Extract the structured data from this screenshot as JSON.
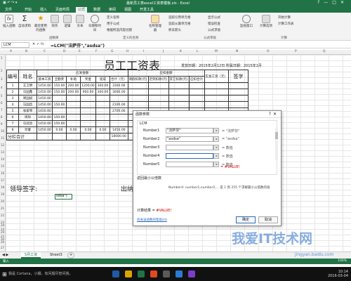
{
  "window": {
    "title": "最新员工表excel工资表模板.xls - Excel",
    "buttons": [
      "?",
      "—",
      "□",
      "✕"
    ],
    "accent_color": "#217346"
  },
  "ribbon": {
    "tabs": [
      "文件",
      "开始",
      "插入",
      "页面布局",
      "公式",
      "数据",
      "审阅",
      "视图",
      "开发工具"
    ],
    "active_tab": "公式",
    "big_buttons": [
      {
        "label": "插入函数",
        "icon": "fx-icon"
      },
      {
        "label": "自动求和",
        "icon": "sum-icon"
      },
      {
        "label": "最近使用的函数",
        "icon": "star-icon"
      },
      {
        "label": "财务",
        "icon": "finance-icon"
      },
      {
        "label": "逻辑",
        "icon": "logic-icon"
      },
      {
        "label": "文本",
        "icon": "text-icon"
      },
      {
        "label": "日期和时间",
        "icon": "clock-icon"
      },
      {
        "label": "名称管理器",
        "icon": "tag-icon"
      },
      {
        "label": "监视窗口",
        "icon": "eye-icon"
      },
      {
        "label": "计算选项",
        "icon": "calc-icon"
      }
    ],
    "small_commands": [
      "定义名称",
      "用于公式",
      "根据所选内容创建",
      "追踪引用单元格",
      "追踪从属单元格",
      "移去箭头",
      "显示公式",
      "错误检查",
      "公式求值",
      "开始计算",
      "计算工作表"
    ],
    "groups": [
      "函数库",
      "定义的名称",
      "公式审核",
      "计算"
    ]
  },
  "formula_bar": {
    "name_box": "LCM",
    "fx_label": "fx",
    "cancel": "✕",
    "confirm": "✓",
    "formula": "=LCM(\"法萨芬\",\"asdsa\")"
  },
  "columns": [
    "A",
    "B",
    "C",
    "D",
    "E",
    "F",
    "G",
    "H",
    "I",
    "J",
    "K",
    "L",
    "M",
    "N",
    "O",
    "P",
    "Q"
  ],
  "rows": [
    "1",
    "2",
    "3",
    "4",
    "5",
    "6",
    "7",
    "8",
    "9",
    "10",
    "11",
    "12",
    "13",
    "14",
    "15",
    "16",
    "17",
    "18",
    "19",
    "20",
    "21",
    "22",
    "23",
    "24",
    "25",
    "26",
    "27",
    "28",
    "29",
    "30"
  ],
  "sheet": {
    "title": "员工工资表",
    "sub": "发放日期：2015年2月12日  所属日期：2015年1月",
    "headers_top": [
      "编号",
      "姓名",
      "应发金额",
      "",
      "",
      "",
      "",
      "",
      "应扣金额",
      "",
      "",
      "",
      "实发工资（元）",
      "签字"
    ],
    "headers_sub": [
      "基本工资",
      "全勤奖",
      "补助",
      "奖金",
      "提成",
      "合计（元）",
      "请假扣款(元)",
      "迟到扣款(元)",
      "其它扣款(元)",
      "应扣合计"
    ],
    "employees": [
      {
        "id": "1",
        "name": "王卫明",
        "base": "1450.00",
        "full": "150.00",
        "allow": "200.00",
        "bonus": "1200.00",
        "comm": "300.00",
        "total": "3300.00"
      },
      {
        "id": "2",
        "name": "马国鑫",
        "base": "1450.00",
        "full": "150.00",
        "allow": "200.00",
        "bonus": "900.00",
        "comm": "300.00",
        "total": "3000.00"
      },
      {
        "id": "3",
        "name": "郑国斌",
        "base": "1450.00",
        "full": "",
        "allow": "",
        "bonus": "",
        "comm": "",
        "total": ""
      },
      {
        "id": "4",
        "name": "马国昌",
        "base": "1450.00",
        "full": "150.00",
        "allow": "",
        "bonus": "",
        "comm": "",
        "total": "2100.00"
      },
      {
        "id": "5",
        "name": "张爱琴",
        "base": "1450.00",
        "full": "",
        "allow": "",
        "bonus": "",
        "comm": "",
        "total": "2700.00"
      },
      {
        "id": "6",
        "name": "周阳",
        "base": "1450.00",
        "full": "150.00",
        "allow": "",
        "bonus": "",
        "comm": "",
        "total": ""
      },
      {
        "id": "7",
        "name": "马冠昌",
        "base": "1450.00",
        "full": "150.00",
        "allow": "",
        "bonus": "",
        "comm": "",
        "total": ""
      },
      {
        "id": "8",
        "name": "邓睿",
        "base": "1450.00",
        "full": "0.00",
        "allow": "0.00",
        "bonus": "0.00",
        "comm": "0.00",
        "total": "1450.00"
      }
    ],
    "subtotal_label": "分栏合计",
    "subtotal_value": "18000.00",
    "leader_label": "领导签字:",
    "leader_label2": "出纳",
    "selected_cell": "sdsa\")"
  },
  "dialog": {
    "title": "函数参数",
    "controls": [
      "?",
      "✕"
    ],
    "function_name": "LCM",
    "args": [
      {
        "label": "Number1",
        "value": "\"法萨芬\"",
        "result": "= \"法萨芬\""
      },
      {
        "label": "Number2",
        "value": "\"asdsa\"",
        "result": "= \"asdsa\""
      },
      {
        "label": "Number3",
        "value": "",
        "result": "= 数值"
      },
      {
        "label": "Number4",
        "value": "",
        "result": "= 数值"
      },
      {
        "label": "Number5",
        "value": "",
        "result": "= 数值"
      }
    ],
    "result": "= #VALUE!",
    "description": "返回最小公倍数",
    "detail": "Number4: number1,number2,... 是 1 到 255 个求解最小公倍数的值",
    "calc_label": "计算结果 =",
    "calc_value": "#VALUE!",
    "help_link": "有关该函数的帮助(H)",
    "ok": "确定",
    "cancel": "取消"
  },
  "sheet_tabs": [
    "5月工资",
    "Sheet3",
    "+"
  ],
  "statusbar": {
    "left": "输入",
    "right": "100%"
  },
  "taskbar": {
    "search": "我是 Cortana，小娜。有问题尽管问我。",
    "time": "10:14",
    "date": "2016-03-04"
  },
  "watermark": {
    "text": "我爱IT技术网",
    "url": "jingyan.baidu.com"
  }
}
